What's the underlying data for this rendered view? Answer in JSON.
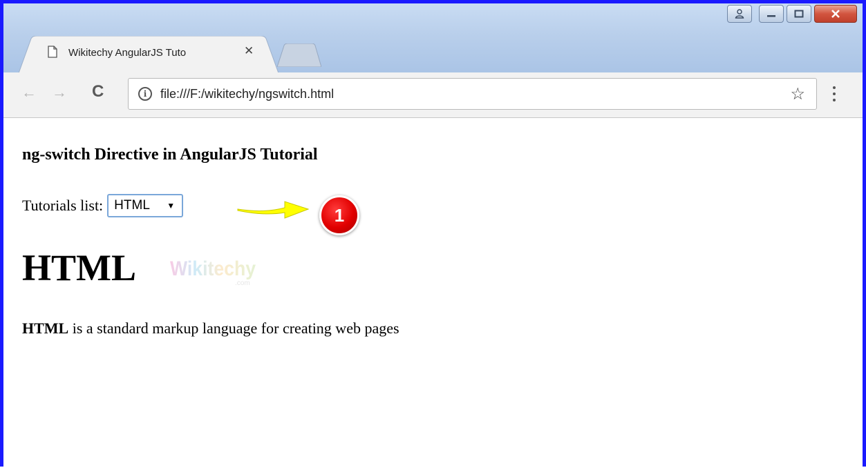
{
  "window": {
    "controls": {
      "user": "user-icon",
      "minimize": "minimize-icon",
      "maximize": "maximize-icon",
      "close": "close-icon"
    }
  },
  "tab": {
    "title": "Wikitechy AngularJS Tuto",
    "close": "✕"
  },
  "toolbar": {
    "back": "←",
    "forward": "→",
    "reload": "C",
    "info": "i",
    "url": "file:///F:/wikitechy/ngswitch.html",
    "star": "☆"
  },
  "page": {
    "heading": "ng-switch Directive in AngularJS Tutorial",
    "tutorials_label": "Tutorials list:",
    "select": {
      "value": "HTML",
      "arrow": "▼"
    },
    "annotation_number": "1",
    "section_title": "HTML",
    "watermark": {
      "brand": "Wikitechy",
      "sub": ".com"
    },
    "description": {
      "bold": "HTML",
      "rest": " is a standard markup language for creating web pages"
    }
  },
  "colors": {
    "frame_border": "#1a1aff",
    "badge_red": "#e10000",
    "arrow_yellow": "#ffff00",
    "select_border": "#7aa7d9"
  }
}
